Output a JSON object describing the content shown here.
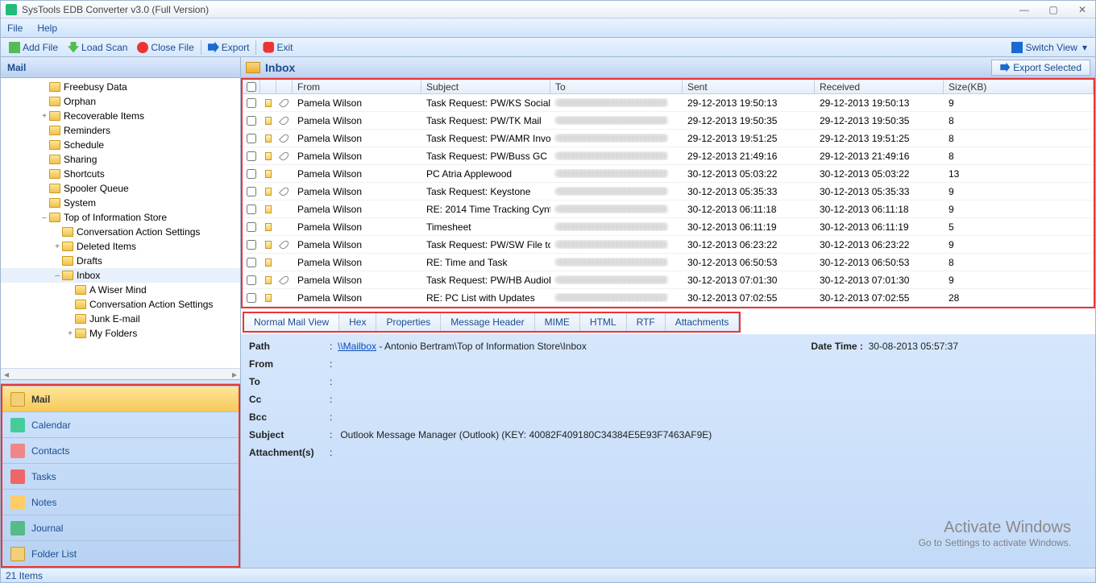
{
  "titlebar": {
    "title": "SysTools EDB Converter v3.0 (Full Version)"
  },
  "menubar": {
    "file": "File",
    "help": "Help"
  },
  "toolbar": {
    "add_file": "Add File",
    "load_scan": "Load Scan",
    "close_file": "Close File",
    "export": "Export",
    "exit": "Exit",
    "switch_view": "Switch View"
  },
  "left": {
    "header": "Mail",
    "tree": [
      {
        "indent": 3,
        "label": "Freebusy Data"
      },
      {
        "indent": 3,
        "label": "Orphan"
      },
      {
        "indent": 3,
        "label": "Recoverable Items",
        "exp": "+"
      },
      {
        "indent": 3,
        "label": "Reminders"
      },
      {
        "indent": 3,
        "label": "Schedule"
      },
      {
        "indent": 3,
        "label": "Sharing"
      },
      {
        "indent": 3,
        "label": "Shortcuts"
      },
      {
        "indent": 3,
        "label": "Spooler Queue"
      },
      {
        "indent": 3,
        "label": "System"
      },
      {
        "indent": 3,
        "label": "Top of Information Store",
        "exp": "–"
      },
      {
        "indent": 4,
        "label": "Conversation Action Settings"
      },
      {
        "indent": 4,
        "label": "Deleted Items",
        "exp": "+"
      },
      {
        "indent": 4,
        "label": "Drafts"
      },
      {
        "indent": 4,
        "label": "Inbox",
        "exp": "–",
        "sel": true
      },
      {
        "indent": 5,
        "label": "A Wiser Mind"
      },
      {
        "indent": 5,
        "label": "Conversation Action Settings"
      },
      {
        "indent": 5,
        "label": "Junk E-mail"
      },
      {
        "indent": 5,
        "label": "My Folders",
        "exp": "+"
      }
    ],
    "nav": [
      {
        "label": "Mail",
        "cls": "ni-mail",
        "sel": true
      },
      {
        "label": "Calendar",
        "cls": "ni-cal"
      },
      {
        "label": "Contacts",
        "cls": "ni-con"
      },
      {
        "label": "Tasks",
        "cls": "ni-task"
      },
      {
        "label": "Notes",
        "cls": "ni-note"
      },
      {
        "label": "Journal",
        "cls": "ni-jour"
      },
      {
        "label": "Folder List",
        "cls": "ni-fl"
      }
    ]
  },
  "right": {
    "title": "Inbox",
    "export_selected": "Export Selected",
    "columns": {
      "from": "From",
      "subject": "Subject",
      "to": "To",
      "sent": "Sent",
      "received": "Received",
      "size": "Size(KB)"
    },
    "rows": [
      {
        "from": "Pamela Wilson",
        "subject": "Task Request: PW/KS Social ...",
        "sent": "29-12-2013 19:50:13",
        "recv": "29-12-2013 19:50:13",
        "size": "9",
        "clip": true
      },
      {
        "from": "Pamela Wilson",
        "subject": "Task Request: PW/TK Mail",
        "sent": "29-12-2013 19:50:35",
        "recv": "29-12-2013 19:50:35",
        "size": "8",
        "clip": true
      },
      {
        "from": "Pamela Wilson",
        "subject": "Task Request: PW/AMR Invoi...",
        "sent": "29-12-2013 19:51:25",
        "recv": "29-12-2013 19:51:25",
        "size": "8",
        "clip": true
      },
      {
        "from": "Pamela Wilson",
        "subject": "Task Request: PW/Buss GC",
        "sent": "29-12-2013 21:49:16",
        "recv": "29-12-2013 21:49:16",
        "size": "8",
        "clip": true
      },
      {
        "from": "Pamela Wilson",
        "subject": "PC Atria Applewood",
        "sent": "30-12-2013 05:03:22",
        "recv": "30-12-2013 05:03:22",
        "size": "13",
        "clip": false
      },
      {
        "from": "Pamela Wilson",
        "subject": "Task Request: Keystone",
        "sent": "30-12-2013 05:35:33",
        "recv": "30-12-2013 05:35:33",
        "size": "9",
        "clip": true
      },
      {
        "from": "Pamela Wilson",
        "subject": "RE: 2014 Time Tracking Cynt...",
        "sent": "30-12-2013 06:11:18",
        "recv": "30-12-2013 06:11:18",
        "size": "9",
        "clip": false
      },
      {
        "from": "Pamela Wilson",
        "subject": "Timesheet",
        "sent": "30-12-2013 06:11:19",
        "recv": "30-12-2013 06:11:19",
        "size": "5",
        "clip": false
      },
      {
        "from": "Pamela Wilson",
        "subject": "Task Request: PW/SW File to...",
        "sent": "30-12-2013 06:23:22",
        "recv": "30-12-2013 06:23:22",
        "size": "9",
        "clip": true
      },
      {
        "from": "Pamela Wilson",
        "subject": "RE: Time and Task",
        "sent": "30-12-2013 06:50:53",
        "recv": "30-12-2013 06:50:53",
        "size": "8",
        "clip": false
      },
      {
        "from": "Pamela Wilson",
        "subject": "Task Request: PW/HB Audiol...",
        "sent": "30-12-2013 07:01:30",
        "recv": "30-12-2013 07:01:30",
        "size": "9",
        "clip": true
      },
      {
        "from": "Pamela Wilson",
        "subject": "RE: PC List with Updates",
        "sent": "30-12-2013 07:02:55",
        "recv": "30-12-2013 07:02:55",
        "size": "28",
        "clip": false
      }
    ],
    "tabs": [
      "Normal Mail View",
      "Hex",
      "Properties",
      "Message Header",
      "MIME",
      "HTML",
      "RTF",
      "Attachments"
    ],
    "detail": {
      "path_label": "Path",
      "path_link": "\\\\Mailbox",
      "path_rest": " - Antonio Bertram\\Top of Information Store\\Inbox",
      "dt_label": "Date Time :",
      "dt_value": "30-08-2013 05:57:37",
      "from": "From",
      "to": "To",
      "cc": "Cc",
      "bcc": "Bcc",
      "subject": "Subject",
      "subject_val": "Outlook Message Manager (Outlook) (KEY: 40082F409180C34384E5E93F7463AF9E)",
      "att": "Attachment(s)"
    }
  },
  "status": "21 Items",
  "watermark": {
    "line1": "Activate Windows",
    "line2": "Go to Settings to activate Windows."
  }
}
